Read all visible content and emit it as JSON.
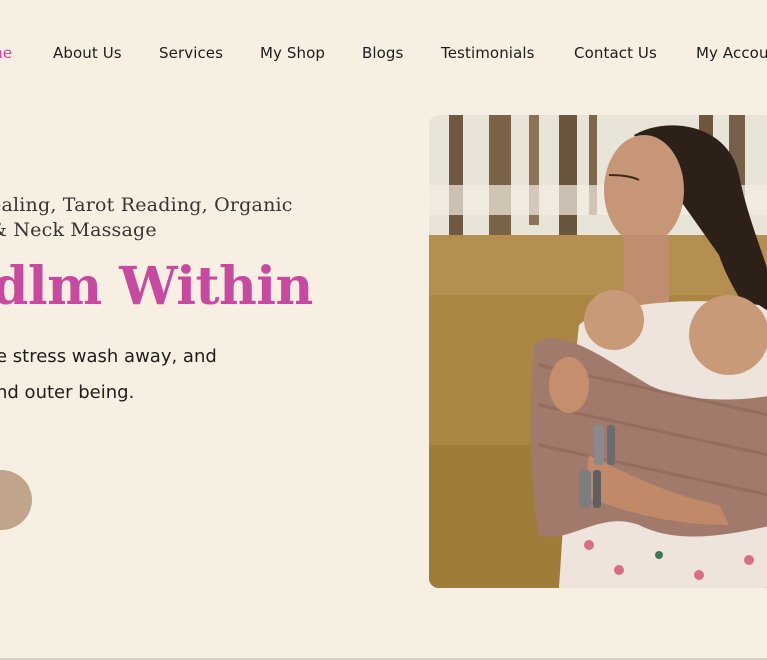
{
  "nav": {
    "items": [
      {
        "label": "Home",
        "visible": "me",
        "active": true
      },
      {
        "label": "About Us"
      },
      {
        "label": "Services"
      },
      {
        "label": "My Shop"
      },
      {
        "label": "Blogs"
      },
      {
        "label": "Testimonials"
      },
      {
        "label": "Contact Us"
      },
      {
        "label": "My Account",
        "visible": "My Accou"
      }
    ]
  },
  "hero": {
    "subtitle_line1": "ealing, Tarot Reading, Organic",
    "subtitle_line2": "& Neck Massage",
    "title": "dlm Within",
    "desc_line1": "e stress wash away, and",
    "desc_line2": "nd outer being."
  },
  "colors": {
    "background": "#f7efe2",
    "accent": "#c84aa0",
    "nav_active": "#d04a9a",
    "cta": "#c0a48c"
  }
}
